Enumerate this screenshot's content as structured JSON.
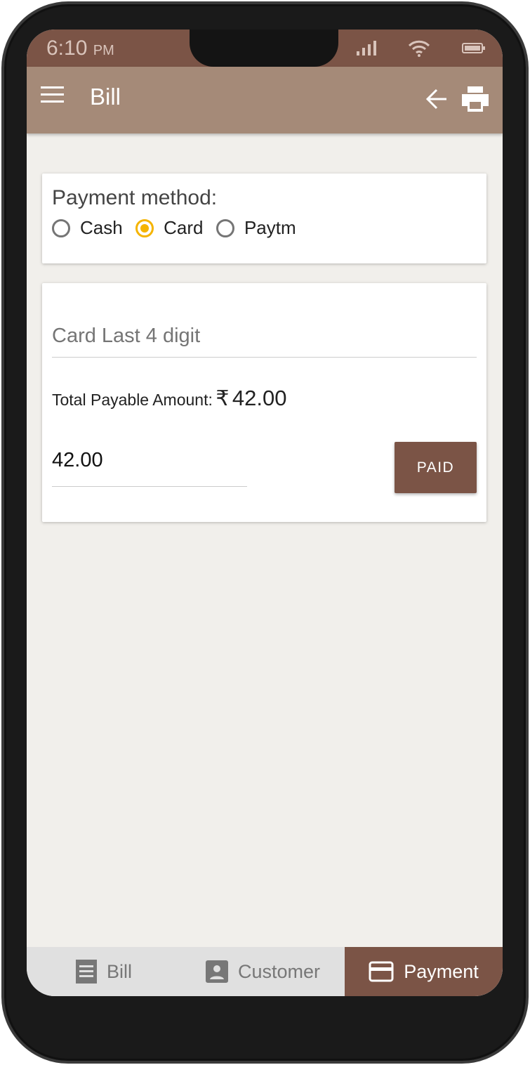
{
  "status_bar": {
    "time": "6:10",
    "ampm": "PM"
  },
  "app_bar": {
    "title": "Bill",
    "menu_icon": "hamburger-menu-icon",
    "back_icon": "arrow-left-icon",
    "print_icon": "printer-icon"
  },
  "payment_method": {
    "label": "Payment method:",
    "options": [
      {
        "label": "Cash",
        "selected": false
      },
      {
        "label": "Card",
        "selected": true
      },
      {
        "label": "Paytm",
        "selected": false
      }
    ]
  },
  "card_form": {
    "card_last4_placeholder": "Card Last 4 digit",
    "total_label": "Total Payable Amount:",
    "currency": "₹",
    "total": "42.00",
    "amount_value": "42.00",
    "paid_button": "PAID"
  },
  "bottom_nav": [
    {
      "label": "Bill",
      "icon": "receipt-icon"
    },
    {
      "label": "Customer",
      "icon": "account-box-icon"
    },
    {
      "label": "Payment",
      "icon": "credit-card-icon",
      "active": true
    }
  ],
  "colors": {
    "primary": "#7b5446",
    "app_bar": "#a58a78",
    "accent": "#f5b400"
  }
}
